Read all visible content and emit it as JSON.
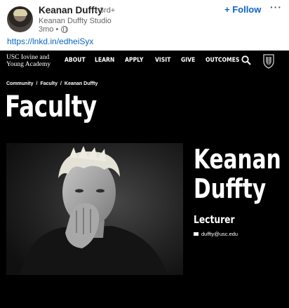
{
  "post": {
    "author_name": "Keanan Duffty",
    "degree": "• 3rd+",
    "headline": "Keanan Duffty Studio",
    "age": "3mo •",
    "follow_label": "+ Follow",
    "more_label": "···",
    "link_text": "https://lnkd.in/edheiSyx",
    "icons": [
      "avatar",
      "globe-icon"
    ]
  },
  "site": {
    "brand_line1": "USC Iovine and",
    "brand_line2": "Young Academy",
    "nav": [
      "ABOUT",
      "LEARN",
      "APPLY",
      "VISIT",
      "GIVE",
      "OUTCOMES"
    ],
    "icons": [
      "search-icon",
      "shield-icon",
      "mail-icon"
    ],
    "breadcrumb": [
      "Community",
      "/",
      "Faculty",
      "/",
      "Keanan Duffty"
    ],
    "page_title": "Faculty",
    "person_first": "Keanan",
    "person_last": "Duffty",
    "person_title": "Lecturer",
    "email": "duffty@usc.edu"
  },
  "colors": {
    "link_blue": "#0a66c2",
    "site_background": "#000000",
    "text_white": "#ffffff"
  }
}
